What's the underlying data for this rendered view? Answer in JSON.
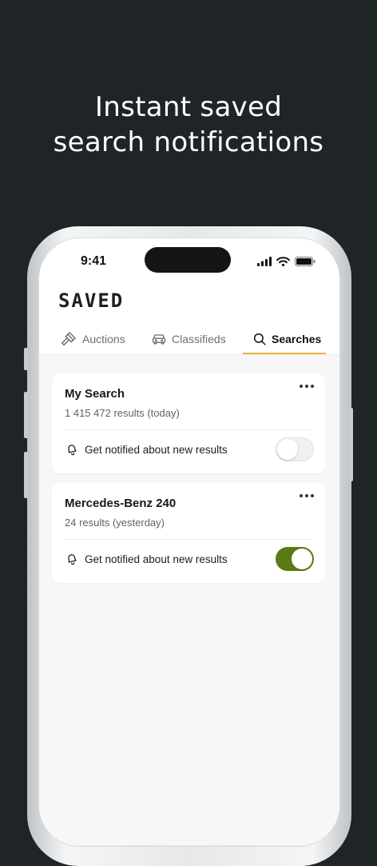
{
  "headline": {
    "line1": "Instant saved",
    "line2": "search notifications"
  },
  "status_bar": {
    "time": "9:41",
    "icons": [
      "signal-icon",
      "wifi-icon",
      "battery-icon"
    ]
  },
  "app": {
    "brand": "SAVED",
    "accent_color": "#e8b53a",
    "toggle_on_color": "#5b7a15"
  },
  "tabs": [
    {
      "label": "Auctions",
      "icon": "gavel-icon",
      "active": false
    },
    {
      "label": "Classifieds",
      "icon": "car-icon",
      "active": false
    },
    {
      "label": "Searches",
      "icon": "search-icon",
      "active": true
    }
  ],
  "searches": [
    {
      "title": "My Search",
      "results": "1 415 472 results (today)",
      "notify_label": "Get notified about new results",
      "notify_enabled": false
    },
    {
      "title": "Mercedes-Benz 240",
      "results": "24 results (yesterday)",
      "notify_label": "Get notified about new results",
      "notify_enabled": true
    }
  ]
}
